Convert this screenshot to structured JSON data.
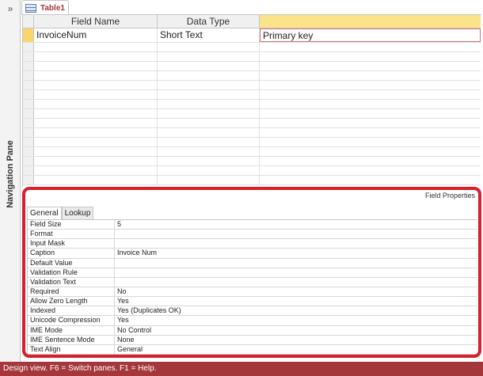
{
  "nav": {
    "chevron": "»",
    "label": "Navigation Pane"
  },
  "tab": {
    "icon": "table-icon",
    "label": "Table1"
  },
  "grid": {
    "headers": {
      "field_name": "Field Name",
      "data_type": "Data Type",
      "description": ""
    },
    "rows": [
      {
        "field_name": "InvoiceNum",
        "data_type": "Short Text",
        "description": "Primary key"
      }
    ]
  },
  "properties": {
    "caption": "Field Properties",
    "tabs": [
      "General",
      "Lookup"
    ],
    "items": [
      {
        "label": "Field Size",
        "value": "5"
      },
      {
        "label": "Format",
        "value": ""
      },
      {
        "label": "Input Mask",
        "value": ""
      },
      {
        "label": "Caption",
        "value": "Invoice Num"
      },
      {
        "label": "Default Value",
        "value": ""
      },
      {
        "label": "Validation Rule",
        "value": ""
      },
      {
        "label": "Validation Text",
        "value": ""
      },
      {
        "label": "Required",
        "value": "No"
      },
      {
        "label": "Allow Zero Length",
        "value": "Yes"
      },
      {
        "label": "Indexed",
        "value": "Yes (Duplicates OK)"
      },
      {
        "label": "Unicode Compression",
        "value": "Yes"
      },
      {
        "label": "IME Mode",
        "value": "No Control"
      },
      {
        "label": "IME Sentence Mode",
        "value": "None"
      },
      {
        "label": "Text Align",
        "value": "General"
      }
    ]
  },
  "status": {
    "text": "Design view.  F6 = Switch panes.  F1 = Help."
  },
  "colors": {
    "accent": "#a4373a",
    "highlight": "#d8202a",
    "header_selected": "#fbe38a"
  }
}
